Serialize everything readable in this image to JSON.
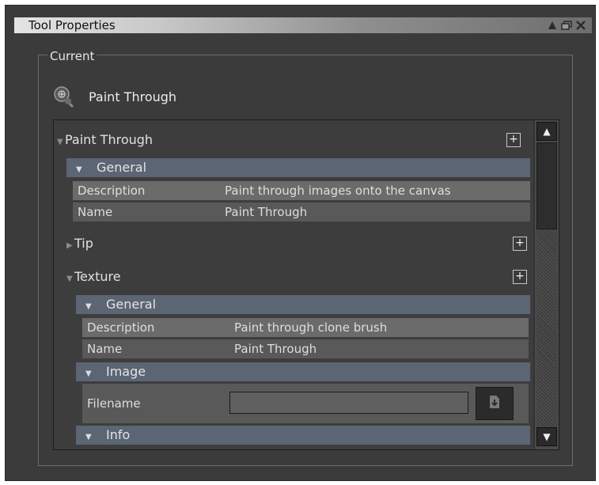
{
  "window": {
    "title": "Tool Properties",
    "controls": [
      "pin-icon",
      "restore-icon",
      "close-icon"
    ]
  },
  "group": {
    "label": "Current"
  },
  "tool": {
    "icon": "paint-through-icon",
    "name": "Paint Through"
  },
  "tree": {
    "paint_through": {
      "label": "Paint Through",
      "general": {
        "label": "General",
        "rows": [
          {
            "key": "Description",
            "value": "Paint through images onto the canvas"
          },
          {
            "key": "Name",
            "value": "Paint Through"
          }
        ]
      }
    },
    "tip": {
      "label": "Tip"
    },
    "texture": {
      "label": "Texture",
      "general": {
        "label": "General",
        "rows": [
          {
            "key": "Description",
            "value": "Paint through clone brush"
          },
          {
            "key": "Name",
            "value": "Paint Through"
          }
        ]
      },
      "image": {
        "label": "Image",
        "filename_label": "Filename",
        "filename_value": ""
      },
      "info": {
        "label": "Info"
      }
    }
  },
  "colors": {
    "panel": "#3b3b3b",
    "subheader": "#5b6574",
    "row_light": "#6b6b6b",
    "row_dark": "#595959"
  }
}
